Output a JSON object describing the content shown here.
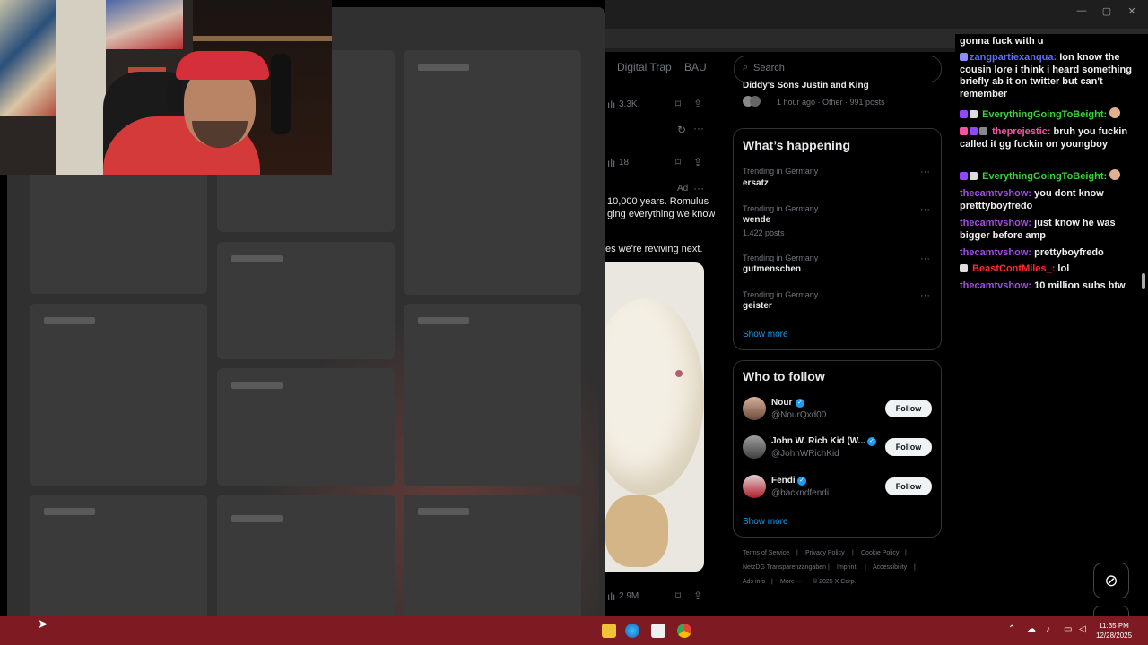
{
  "browser": {
    "window_controls": [
      "—",
      "▢",
      "✕"
    ]
  },
  "feed": {
    "tabs": [
      "Digital Trap",
      "BAU"
    ],
    "post1_views": "3.3K",
    "post2_views": "18",
    "ad_label": "Ad",
    "ad_text_line1": "10,000 years. Romulus",
    "ad_text_line2": "ging everything we know",
    "ad_text_line3": "es we're reviving next.",
    "post3_views": "2.9M"
  },
  "sidebar": {
    "search_placeholder": "Search",
    "trend_top": {
      "title": "Diddy's Sons Justin and King",
      "meta": "1 hour ago · Other · 991 posts"
    },
    "whats_happening": {
      "heading": "What’s happening",
      "trends": [
        {
          "context": "Trending in Germany",
          "name": "ersatz",
          "count": ""
        },
        {
          "context": "Trending in Germany",
          "name": "wende",
          "count": "1,422 posts"
        },
        {
          "context": "Trending in Germany",
          "name": "gutmenschen",
          "count": ""
        },
        {
          "context": "Trending in Germany",
          "name": "geister",
          "count": ""
        }
      ],
      "show_more": "Show more"
    },
    "who_to_follow": {
      "heading": "Who to follow",
      "accounts": [
        {
          "name": "Nour",
          "handle": "@NourQxd00",
          "button": "Follow"
        },
        {
          "name": "John W. Rich Kid (W...",
          "handle": "@JohnWRichKid",
          "button": "Follow"
        },
        {
          "name": "Fendi",
          "handle": "@backndfendi",
          "button": "Follow"
        }
      ],
      "show_more": "Show more"
    },
    "footer": {
      "line1": [
        "Terms of Service",
        "|",
        "Privacy Policy",
        "|",
        "Cookie Policy",
        "|"
      ],
      "line2": [
        "NetzDG Transparenzangaben",
        "|",
        "Imprint",
        "|",
        "Accessibility",
        "|"
      ],
      "line3": [
        "Ads info",
        "|",
        "More ···",
        "© 2025 X Corp."
      ]
    }
  },
  "chat": {
    "messages": [
      {
        "user": "",
        "text": "gonna fuck with u",
        "color": "#efeff1"
      },
      {
        "user": "zangpartiexanqua:",
        "text": "Ion know the cousin lore i think i heard something briefly ab it on twitter but can't remember",
        "color": "#5b6cff"
      },
      {
        "user": "EverythingGoingToBeight:",
        "text": "",
        "color": "#3ad13a"
      },
      {
        "user": "theprejestic:",
        "text": "bruh you fuckin called it gg fuckin on youngboy",
        "color": "#ff4fa1"
      },
      {
        "user": "EverythingGoingToBeight:",
        "text": "",
        "color": "#3ad13a"
      },
      {
        "user": "thecamtvshow:",
        "text": "you dont know pretttyboyfredo",
        "color": "#a04de8"
      },
      {
        "user": "thecamtvshow:",
        "text": "just know he was bigger before amp",
        "color": "#a04de8"
      },
      {
        "user": "thecamtvshow:",
        "text": "prettyboyfredo",
        "color": "#a04de8"
      },
      {
        "user": "BeastContMiles_:",
        "text": "lol",
        "color": "#ff2a2a"
      },
      {
        "user": "thecamtvshow:",
        "text": "10 million subs btw",
        "color": "#a04de8"
      }
    ]
  },
  "taskbar": {
    "time": "11:35 PM",
    "date": "12/28/2025"
  },
  "colors": {
    "accent": "#1d9bf0",
    "taskbar": "#7d1a22",
    "panel": "#303030"
  }
}
